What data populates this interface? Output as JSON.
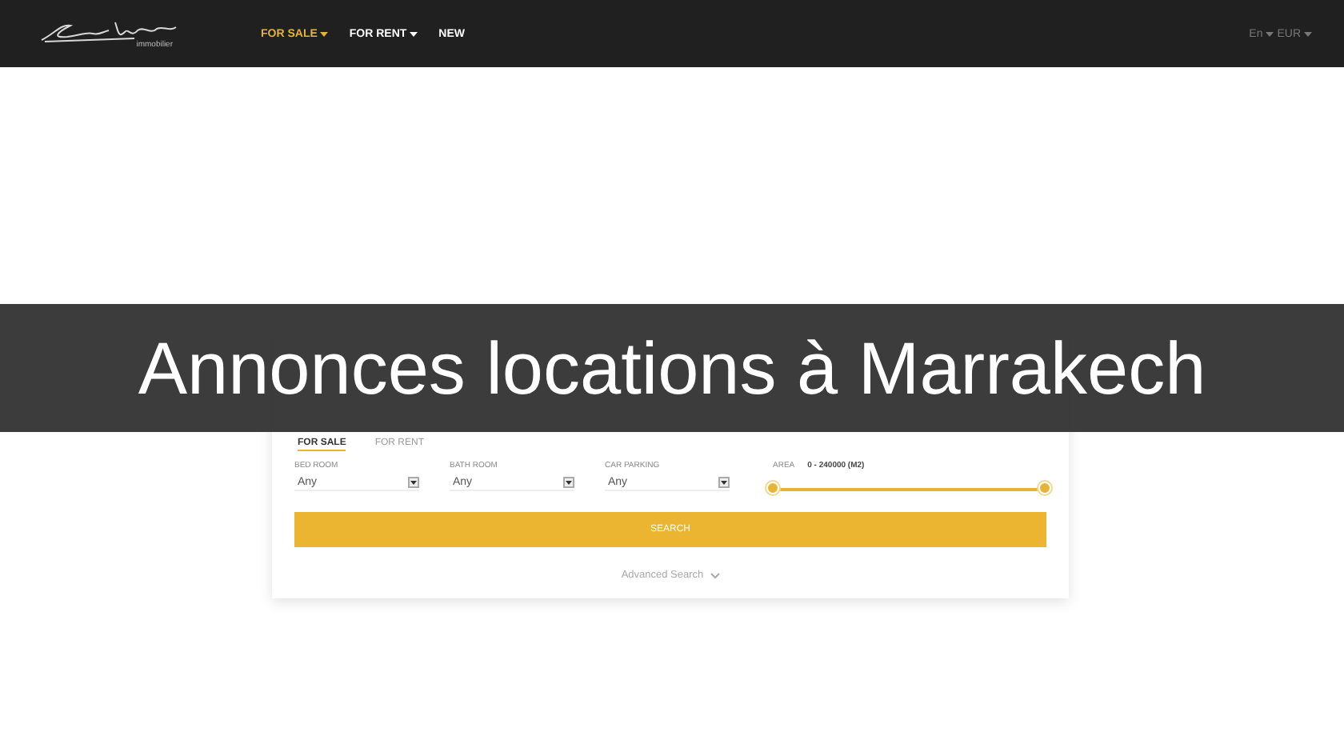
{
  "header": {
    "logo_subtitle": "immobilier",
    "nav": [
      {
        "label": "FOR SALE",
        "selected": true,
        "dropdown": true
      },
      {
        "label": "FOR RENT",
        "selected": false,
        "dropdown": true
      },
      {
        "label": "NEW",
        "selected": false,
        "dropdown": false
      }
    ],
    "language": "En",
    "currency": "EUR"
  },
  "banner": {
    "title": "Annonces locations à Marrakech"
  },
  "search_form": {
    "tabs": [
      {
        "label": "FOR SALE",
        "selected": true
      },
      {
        "label": "FOR RENT",
        "selected": false
      }
    ],
    "fields": [
      {
        "label": "BED ROOM",
        "value": "Any"
      },
      {
        "label": "BATH ROOM",
        "value": "Any"
      },
      {
        "label": "CAR PARKING",
        "value": "Any"
      }
    ],
    "area": {
      "label": "AREA",
      "range": "0 - 240000 (M2)",
      "level": 1
    },
    "search_button": "SEARCH",
    "advanced_search": "Advanced Search"
  }
}
